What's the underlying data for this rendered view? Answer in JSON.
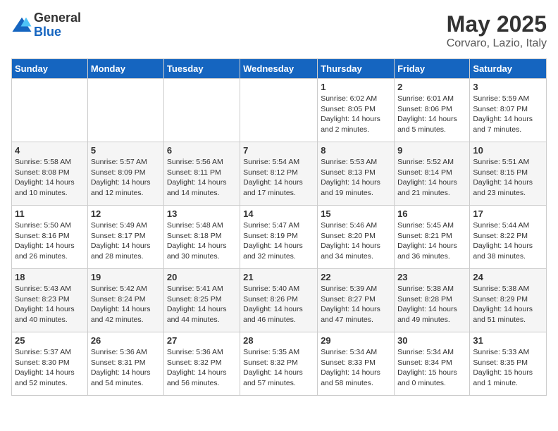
{
  "header": {
    "logo_general": "General",
    "logo_blue": "Blue",
    "month": "May 2025",
    "location": "Corvaro, Lazio, Italy"
  },
  "days_of_week": [
    "Sunday",
    "Monday",
    "Tuesday",
    "Wednesday",
    "Thursday",
    "Friday",
    "Saturday"
  ],
  "weeks": [
    [
      {
        "day": "",
        "info": ""
      },
      {
        "day": "",
        "info": ""
      },
      {
        "day": "",
        "info": ""
      },
      {
        "day": "",
        "info": ""
      },
      {
        "day": "1",
        "info": "Sunrise: 6:02 AM\nSunset: 8:05 PM\nDaylight: 14 hours\nand 2 minutes."
      },
      {
        "day": "2",
        "info": "Sunrise: 6:01 AM\nSunset: 8:06 PM\nDaylight: 14 hours\nand 5 minutes."
      },
      {
        "day": "3",
        "info": "Sunrise: 5:59 AM\nSunset: 8:07 PM\nDaylight: 14 hours\nand 7 minutes."
      }
    ],
    [
      {
        "day": "4",
        "info": "Sunrise: 5:58 AM\nSunset: 8:08 PM\nDaylight: 14 hours\nand 10 minutes."
      },
      {
        "day": "5",
        "info": "Sunrise: 5:57 AM\nSunset: 8:09 PM\nDaylight: 14 hours\nand 12 minutes."
      },
      {
        "day": "6",
        "info": "Sunrise: 5:56 AM\nSunset: 8:11 PM\nDaylight: 14 hours\nand 14 minutes."
      },
      {
        "day": "7",
        "info": "Sunrise: 5:54 AM\nSunset: 8:12 PM\nDaylight: 14 hours\nand 17 minutes."
      },
      {
        "day": "8",
        "info": "Sunrise: 5:53 AM\nSunset: 8:13 PM\nDaylight: 14 hours\nand 19 minutes."
      },
      {
        "day": "9",
        "info": "Sunrise: 5:52 AM\nSunset: 8:14 PM\nDaylight: 14 hours\nand 21 minutes."
      },
      {
        "day": "10",
        "info": "Sunrise: 5:51 AM\nSunset: 8:15 PM\nDaylight: 14 hours\nand 23 minutes."
      }
    ],
    [
      {
        "day": "11",
        "info": "Sunrise: 5:50 AM\nSunset: 8:16 PM\nDaylight: 14 hours\nand 26 minutes."
      },
      {
        "day": "12",
        "info": "Sunrise: 5:49 AM\nSunset: 8:17 PM\nDaylight: 14 hours\nand 28 minutes."
      },
      {
        "day": "13",
        "info": "Sunrise: 5:48 AM\nSunset: 8:18 PM\nDaylight: 14 hours\nand 30 minutes."
      },
      {
        "day": "14",
        "info": "Sunrise: 5:47 AM\nSunset: 8:19 PM\nDaylight: 14 hours\nand 32 minutes."
      },
      {
        "day": "15",
        "info": "Sunrise: 5:46 AM\nSunset: 8:20 PM\nDaylight: 14 hours\nand 34 minutes."
      },
      {
        "day": "16",
        "info": "Sunrise: 5:45 AM\nSunset: 8:21 PM\nDaylight: 14 hours\nand 36 minutes."
      },
      {
        "day": "17",
        "info": "Sunrise: 5:44 AM\nSunset: 8:22 PM\nDaylight: 14 hours\nand 38 minutes."
      }
    ],
    [
      {
        "day": "18",
        "info": "Sunrise: 5:43 AM\nSunset: 8:23 PM\nDaylight: 14 hours\nand 40 minutes."
      },
      {
        "day": "19",
        "info": "Sunrise: 5:42 AM\nSunset: 8:24 PM\nDaylight: 14 hours\nand 42 minutes."
      },
      {
        "day": "20",
        "info": "Sunrise: 5:41 AM\nSunset: 8:25 PM\nDaylight: 14 hours\nand 44 minutes."
      },
      {
        "day": "21",
        "info": "Sunrise: 5:40 AM\nSunset: 8:26 PM\nDaylight: 14 hours\nand 46 minutes."
      },
      {
        "day": "22",
        "info": "Sunrise: 5:39 AM\nSunset: 8:27 PM\nDaylight: 14 hours\nand 47 minutes."
      },
      {
        "day": "23",
        "info": "Sunrise: 5:38 AM\nSunset: 8:28 PM\nDaylight: 14 hours\nand 49 minutes."
      },
      {
        "day": "24",
        "info": "Sunrise: 5:38 AM\nSunset: 8:29 PM\nDaylight: 14 hours\nand 51 minutes."
      }
    ],
    [
      {
        "day": "25",
        "info": "Sunrise: 5:37 AM\nSunset: 8:30 PM\nDaylight: 14 hours\nand 52 minutes."
      },
      {
        "day": "26",
        "info": "Sunrise: 5:36 AM\nSunset: 8:31 PM\nDaylight: 14 hours\nand 54 minutes."
      },
      {
        "day": "27",
        "info": "Sunrise: 5:36 AM\nSunset: 8:32 PM\nDaylight: 14 hours\nand 56 minutes."
      },
      {
        "day": "28",
        "info": "Sunrise: 5:35 AM\nSunset: 8:32 PM\nDaylight: 14 hours\nand 57 minutes."
      },
      {
        "day": "29",
        "info": "Sunrise: 5:34 AM\nSunset: 8:33 PM\nDaylight: 14 hours\nand 58 minutes."
      },
      {
        "day": "30",
        "info": "Sunrise: 5:34 AM\nSunset: 8:34 PM\nDaylight: 15 hours\nand 0 minutes."
      },
      {
        "day": "31",
        "info": "Sunrise: 5:33 AM\nSunset: 8:35 PM\nDaylight: 15 hours\nand 1 minute."
      }
    ]
  ]
}
